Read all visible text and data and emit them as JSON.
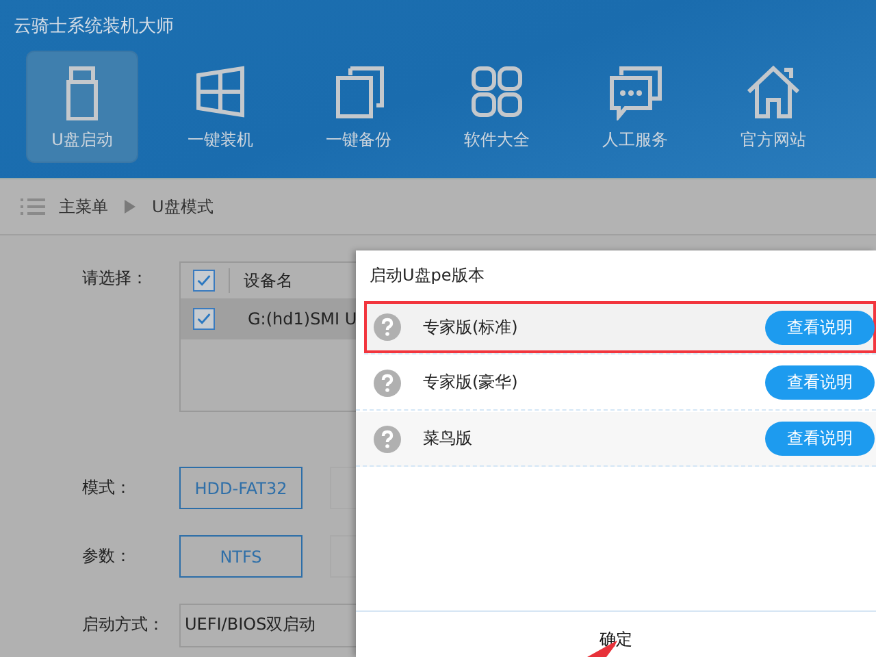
{
  "window": {
    "title": "云骑士系统装机大师"
  },
  "nav": [
    {
      "label": "U盘启动",
      "kind": "usb",
      "selected": true
    },
    {
      "label": "一键装机",
      "kind": "windows",
      "selected": false
    },
    {
      "label": "一键备份",
      "kind": "copy",
      "selected": false
    },
    {
      "label": "软件大全",
      "kind": "apps",
      "selected": false
    },
    {
      "label": "人工服务",
      "kind": "chat",
      "selected": false
    },
    {
      "label": "官方网站",
      "kind": "home",
      "selected": false
    }
  ],
  "breadcrumb": [
    "主菜单",
    "U盘模式"
  ],
  "form": {
    "select_label": "请选择：",
    "device_table": {
      "columns": [
        "设备名"
      ],
      "header_checked": true,
      "rows": [
        {
          "name": "G:(hd1)SMI U",
          "checked": true
        }
      ]
    },
    "mode_label": "模式：",
    "modes": [
      {
        "label": "HDD-FAT32",
        "selected": true
      },
      {
        "selected": false
      }
    ],
    "param_label": "参数：",
    "params": [
      {
        "label": "NTFS",
        "selected": true
      },
      {
        "selected": false
      }
    ],
    "boot_label": "启动方式：",
    "boot_value": "UEFI/BIOS双启动"
  },
  "dialog": {
    "title": "启动U盘pe版本",
    "rows": [
      {
        "label": "专家版(标准)",
        "button": "查看说明",
        "highlighted": true
      },
      {
        "label": "专家版(豪华)",
        "button": "查看说明",
        "highlighted": false
      },
      {
        "label": "菜鸟版",
        "button": "查看说明",
        "highlighted": false
      }
    ],
    "confirm": {
      "label": "确定",
      "pointed": true
    }
  }
}
